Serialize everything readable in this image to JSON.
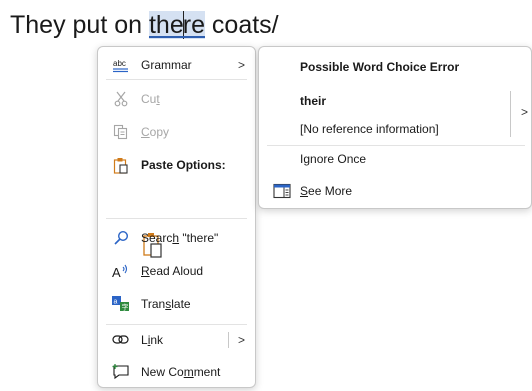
{
  "document": {
    "before": "They put on ",
    "word_part1": "the",
    "word_part2": "re",
    "after": " coats/"
  },
  "context_menu": {
    "grammar": {
      "label": "Grammar",
      "icon": "abc-spelling-icon",
      "arrow": ">"
    },
    "cut": {
      "label_pre": "Cu",
      "label_ul": "t",
      "icon": "scissors-icon"
    },
    "copy": {
      "label_pre": "",
      "label_ul": "C",
      "label_post": "opy",
      "icon": "copy-icon"
    },
    "paste_options": {
      "label": "Paste Options:",
      "icon": "clipboard-icon"
    },
    "search": {
      "label_pre": "Searc",
      "label_ul": "h",
      "label_post": " \"there\"",
      "icon": "search-icon"
    },
    "read_aloud": {
      "label_ul": "R",
      "label_post": "ead Aloud",
      "icon": "read-aloud-icon"
    },
    "translate": {
      "label_pre": "Tran",
      "label_ul": "s",
      "label_post": "late",
      "icon": "translate-icon"
    },
    "link": {
      "label_pre": "L",
      "label_ul": "i",
      "label_post": "nk",
      "icon": "link-icon",
      "arrow": ">"
    },
    "new_comment": {
      "label_pre": "New Co",
      "label_ul": "m",
      "label_post": "ment",
      "icon": "comment-icon"
    }
  },
  "submenu": {
    "title": "Possible Word Choice Error",
    "suggestion": "their",
    "reference": "[No reference information]",
    "arrow": ">",
    "ignore": {
      "label_pre": "I",
      "label_ul": "g",
      "label_post": "nore Once"
    },
    "see_more": {
      "label_ul": "S",
      "label_post": "ee More",
      "icon": "see-more-icon"
    }
  },
  "colors": {
    "selection": "#d5e1f2",
    "accent_blue": "#2b64c6",
    "icon_orange": "#d07b1a",
    "icon_green": "#2e8b3e",
    "disabled": "#a6a6a6"
  }
}
